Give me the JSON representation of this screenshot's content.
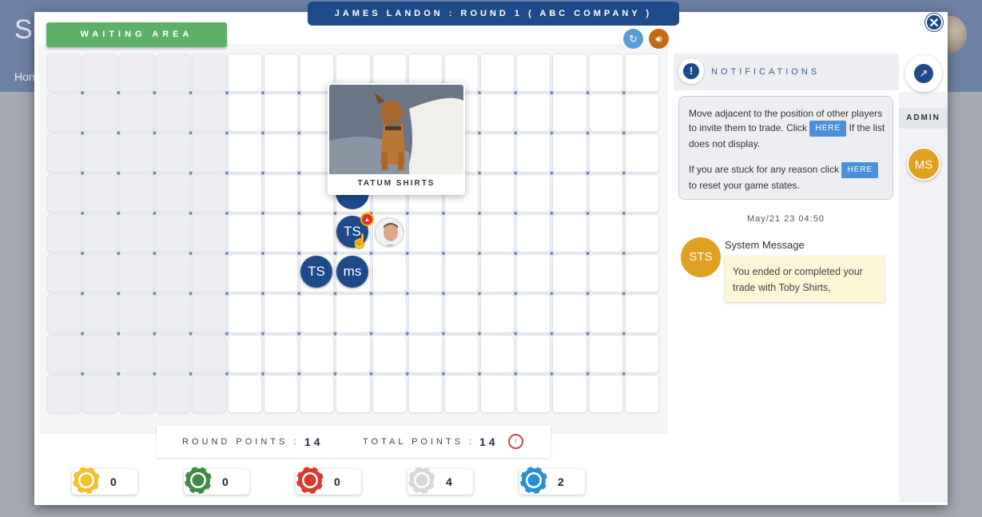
{
  "background": {
    "logo_text": "Si",
    "nav_text": "Hon"
  },
  "header": {
    "title": "JAMES LANDON : ROUND 1 ( ABC COMPANY )",
    "close_symbol": "✕"
  },
  "toolbar": {
    "waiting_area_label": "WAITING AREA",
    "refresh_icon": "refresh-icon",
    "sound_icon": "speaker-icon"
  },
  "board": {
    "columns": 17,
    "rows": 9,
    "waiting_columns": 5,
    "popup_name": "TATUM SHIRTS",
    "tokens": [
      {
        "label": "TS"
      },
      {
        "label": "TS"
      },
      {
        "label": "ms"
      }
    ]
  },
  "points": {
    "round_label": "ROUND POINTS :",
    "round_value": "14",
    "total_label": "TOTAL POINTS :",
    "total_value": "14"
  },
  "chips": [
    {
      "color": "#f2c12e",
      "value": "0"
    },
    {
      "color": "#3f8a45",
      "value": "0"
    },
    {
      "color": "#d83a2e",
      "value": "0"
    },
    {
      "color": "#d8d8d8",
      "value": "4"
    },
    {
      "color": "#2a8fd6",
      "value": "2"
    }
  ],
  "notifications": {
    "title": "NOTIFICATIONS",
    "info_line1": "Move adjacent to the position of other players to invite them to trade. Click",
    "info_line1_after": "If the list does not display.",
    "info_line2": "If you are stuck for any reason click",
    "info_line2_after": "to reset your game states.",
    "here_label": "HERE",
    "date": "May/21 23 04:50",
    "sender_initials": "STS",
    "sender_title": "System Message",
    "message": "You ended or completed your trade with Toby Shirts,"
  },
  "admin": {
    "label": "ADMIN",
    "avatar_initials": "MS"
  },
  "colors": {
    "primary": "#1f4a8a",
    "waiting_green": "#5cb067",
    "avatar_gold": "#e0a020"
  }
}
